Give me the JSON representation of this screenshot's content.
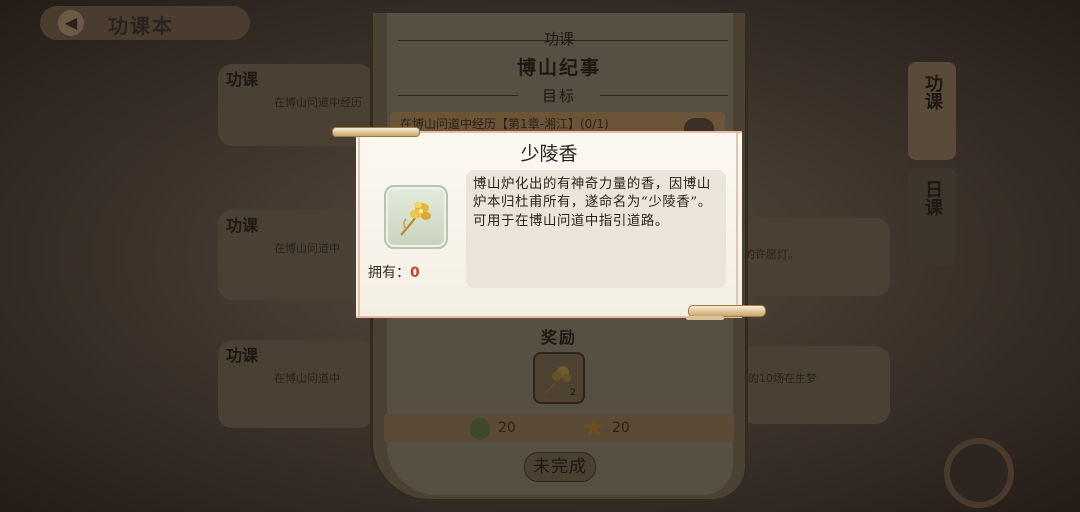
{
  "background": {
    "header_title": "功课本",
    "cards": [
      {
        "label": "功课",
        "text": "在博山问道中经历"
      },
      {
        "label": "功课",
        "text": "在博山问道中",
        "right_text": "的许愿灯。"
      },
      {
        "label": "功课",
        "text": "在博山问道中",
        "right_text": "的10场在生梦"
      }
    ],
    "right_tabs": [
      "功课",
      "日课"
    ]
  },
  "quest": {
    "section_label": "功课",
    "title": "博山纪事",
    "goal_header": "目标",
    "goal_text": "在博山问道中经历【第1章-湘江】(0/1)",
    "reward_header": "奖励",
    "reward_count": "2",
    "currency_1": "20",
    "currency_2": "20",
    "status_button": "未完成"
  },
  "item_popup": {
    "title": "少陵香",
    "owned_label": "拥有：",
    "owned_value": "0",
    "description": "博山炉化出的有神奇力量的香，因博山炉本归杜甫所有，遂命名为“少陵香”。可用于在博山问道中指引道路。"
  }
}
